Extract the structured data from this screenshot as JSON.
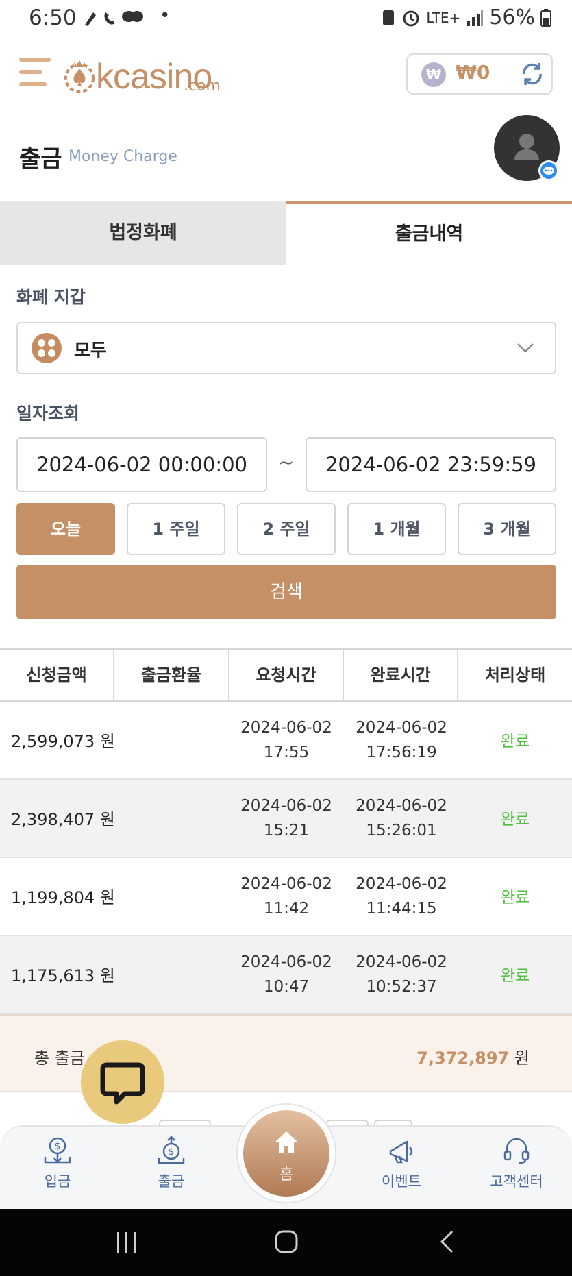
{
  "status_bar": {
    "time": "6:50",
    "battery": "56%",
    "network": "LTE+"
  },
  "header": {
    "logo_text": "kcasino",
    "logo_sub": ".com",
    "wallet_currency_symbol": "₩",
    "wallet_balance": "₩0"
  },
  "page": {
    "title": "출금",
    "subtitle": "Money Charge"
  },
  "tabs": [
    {
      "label": "법정화폐",
      "active": false
    },
    {
      "label": "출금내역",
      "active": true
    }
  ],
  "wallet_filter": {
    "label": "화폐 지갑",
    "selected": "모두"
  },
  "date_filter": {
    "label": "일자조회",
    "start": "2024-06-02 00:00:00",
    "separator": "~",
    "end": "2024-06-02 23:59:59",
    "periods": [
      {
        "label": "오늘",
        "active": true
      },
      {
        "label": "1 주일",
        "active": false
      },
      {
        "label": "2 주일",
        "active": false
      },
      {
        "label": "1 개월",
        "active": false
      },
      {
        "label": "3 개월",
        "active": false
      }
    ],
    "search_label": "검색"
  },
  "table": {
    "columns": [
      "신청금액",
      "출금환율",
      "요청시간",
      "완료시간",
      "처리상태"
    ],
    "rows": [
      {
        "amount": "2,599,073 원",
        "rate": "",
        "req_date": "2024-06-02",
        "req_time": "17:55",
        "done_date": "2024-06-02",
        "done_time": "17:56:19",
        "status": "완료"
      },
      {
        "amount": "2,398,407 원",
        "rate": "",
        "req_date": "2024-06-02",
        "req_time": "15:21",
        "done_date": "2024-06-02",
        "done_time": "15:26:01",
        "status": "완료"
      },
      {
        "amount": "1,199,804 원",
        "rate": "",
        "req_date": "2024-06-02",
        "req_time": "11:42",
        "done_date": "2024-06-02",
        "done_time": "11:44:15",
        "status": "완료"
      },
      {
        "amount": "1,175,613 원",
        "rate": "",
        "req_date": "2024-06-02",
        "req_time": "10:47",
        "done_date": "2024-06-02",
        "done_time": "10:52:37",
        "status": "완료"
      }
    ],
    "total_label": "총 출금",
    "total_value": "7,372,897",
    "total_unit": "원"
  },
  "bottom_nav": [
    {
      "label": "입금",
      "icon": "deposit-icon"
    },
    {
      "label": "출금",
      "icon": "withdraw-icon"
    },
    {
      "label": "홈",
      "icon": "home-icon"
    },
    {
      "label": "이벤트",
      "icon": "megaphone-icon"
    },
    {
      "label": "고객센터",
      "icon": "headset-icon"
    }
  ],
  "colors": {
    "accent": "#c69066",
    "status_done": "#4fbf3e",
    "chat_button": "#e9c97b"
  }
}
